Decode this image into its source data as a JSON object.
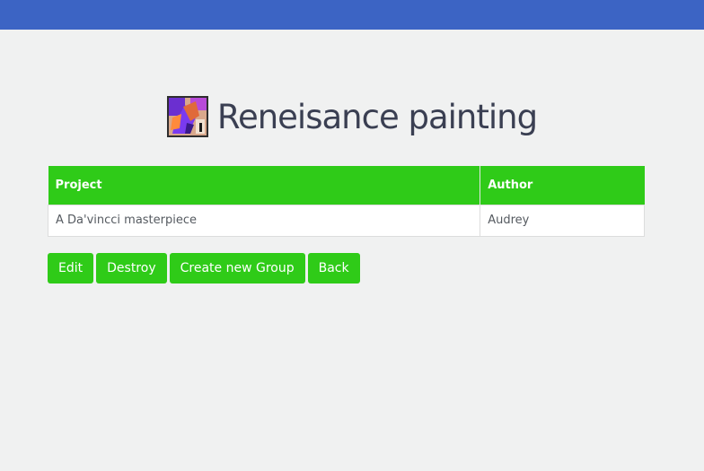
{
  "header": {
    "bar_color": "#3c64c4"
  },
  "group": {
    "title": "Reneisance painting",
    "icon": "group-avatar-icon"
  },
  "table": {
    "columns": [
      "Project",
      "Author"
    ],
    "rows": [
      [
        "A Da'vincci masterpiece",
        "Audrey"
      ]
    ]
  },
  "actions": {
    "edit_label": "Edit",
    "destroy_label": "Destroy",
    "create_label": "Create new Group",
    "back_label": "Back"
  },
  "colors": {
    "accent": "#2fcb18",
    "background": "#f0f1f1",
    "title_text": "#3a3f52"
  }
}
